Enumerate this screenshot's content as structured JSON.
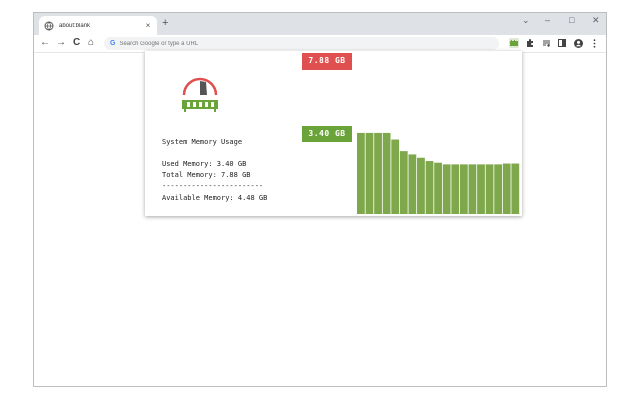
{
  "browser": {
    "tab_title": "about:blank",
    "tab_close": "×",
    "new_tab": "+",
    "omnibox_placeholder": "Search Google or type a URL",
    "omnibox_g": "G",
    "minimize": "–",
    "maximize": "□",
    "close": "✕",
    "chevron": "⌄",
    "back": "←",
    "forward": "→",
    "reload": "C",
    "home": "⌂",
    "icons": [
      "globe-icon",
      "search-icon",
      "memory-extension-icon",
      "puzzle-icon",
      "media-icon",
      "sidepanel-icon",
      "profile-icon",
      "kebab-menu-icon"
    ]
  },
  "popup": {
    "icon": "memory-gauge-icon",
    "heading": "System Memory Usage",
    "used_line": "Used Memory: 3.40 GB",
    "total_line": "Total Memory: 7.88 GB",
    "divider": "------------------------",
    "available_line": "Available Memory: 4.48 GB",
    "total_badge": "7.88 GB",
    "used_badge": "3.40 GB",
    "colors": {
      "red": "#e05050",
      "green": "#6aa33a",
      "bar": "#7fa84c"
    }
  },
  "chart_data": {
    "type": "bar",
    "values": [
      3.92,
      3.92,
      3.92,
      3.92,
      3.6,
      3.04,
      2.88,
      2.72,
      2.56,
      2.48,
      2.4,
      2.4,
      2.4,
      2.4,
      2.4,
      2.4,
      2.4,
      2.44,
      2.44
    ],
    "ylim": [
      0,
      7.88
    ]
  }
}
